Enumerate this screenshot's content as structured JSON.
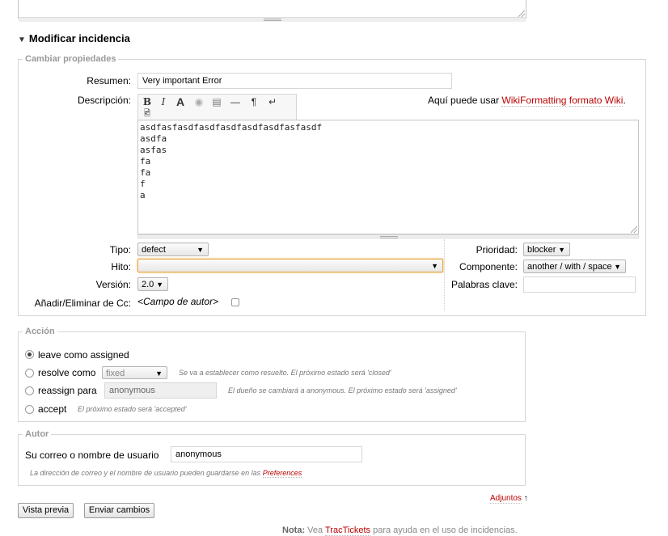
{
  "heading": {
    "toggle": "▼",
    "title": "Modificar incidencia"
  },
  "properties": {
    "legend": "Cambiar propiedades",
    "summary_label": "Resumen:",
    "summary_value": "Very important Error",
    "description_label": "Descripción:",
    "wiki_hint_prefix": "Aquí puede usar ",
    "wiki_link_1": "WikiFormatting",
    "wiki_link_2": "formato Wiki",
    "wiki_hint_suffix": ".",
    "toolbar": [
      "B",
      "I",
      "A",
      "◉",
      "▤",
      "—",
      "¶",
      "↵",
      "🖻"
    ],
    "description_lines": [
      "asdfasfasdfasdfasdfasdfasdfasfasdf",
      "asdfa",
      "asfas",
      "fa",
      "fa",
      "f",
      "a"
    ],
    "type_label": "Tipo:",
    "type_value": "defect",
    "milestone_label": "Hito:",
    "milestone_value": "",
    "version_label": "Versión:",
    "version_value": "2.0",
    "cc_label": "Añadir/Eliminar de Cc:",
    "cc_field": "<Campo de autor>",
    "priority_label": "Prioridad:",
    "priority_value": "blocker",
    "component_label": "Componente:",
    "component_value": "another / with / space",
    "keywords_label": "Palabras clave:",
    "keywords_value": ""
  },
  "action": {
    "legend": "Acción",
    "options": [
      {
        "label": "leave como assigned",
        "selected": true
      },
      {
        "label": "resolve como",
        "select_value": "fixed",
        "hint": "Se va a establecer como resuelto. El próximo estado será 'closed'"
      },
      {
        "label": "reassign para",
        "input_value": "anonymous",
        "hint": "El dueño se cambiará a anonymous. El próximo estado será 'assigned'"
      },
      {
        "label": "accept",
        "hint": "El próximo estado será 'accepted'"
      }
    ]
  },
  "author": {
    "legend": "Autor",
    "label": "Su correo o nombre de usuario",
    "value": "anonymous",
    "hint_prefix": "La dirección de correo y el nombre de usuario pueden guardarse en las ",
    "hint_link": "Preferences"
  },
  "attachments": {
    "label": "Adjuntos",
    "arrow": "↑"
  },
  "buttons": {
    "preview": "Vista previa",
    "submit": "Enviar cambios"
  },
  "note": {
    "prefix": "Nota:",
    "text1": " Vea ",
    "link": "TracTickets",
    "text2": " para ayuda en el uso de incidencias."
  },
  "arrow_glyph": "▼"
}
